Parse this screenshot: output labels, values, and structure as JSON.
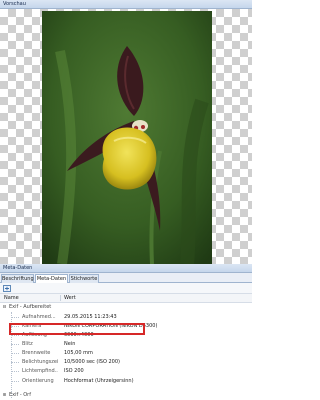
{
  "preview": {
    "title": "Vorschau"
  },
  "metadata_panel": {
    "title": "Meta-Daten",
    "tabs": [
      {
        "label": "Beschriftung",
        "active": false
      },
      {
        "label": "Meta-Daten",
        "active": true
      },
      {
        "label": "Stichworte",
        "active": false
      }
    ],
    "toolbar": {
      "expand_icon": "expand-icon"
    },
    "columns": {
      "name": "Name",
      "value": "Wert"
    },
    "groups": [
      {
        "label": "Exif - Aufbereitet",
        "expanded": true
      },
      {
        "label": "Exif - Orf",
        "expanded": false
      }
    ],
    "properties": [
      {
        "name": "Aufnahmed...",
        "value": "29.05.2015 11:23:43"
      },
      {
        "name": "Kamera",
        "value": "NIKON CORPORATION (NIKON D5300)"
      },
      {
        "name": "Auflösung",
        "value": "6000×4000"
      },
      {
        "name": "Blitz",
        "value": "Nein"
      },
      {
        "name": "Brennweite",
        "value": "105,00 mm"
      },
      {
        "name": "Belichtungszeit",
        "value": "10/5000 sec (ISO 200)"
      },
      {
        "name": "Lichtempfind...",
        "value": "ISO 200"
      },
      {
        "name": "Orientierung",
        "value": "Hochformat (Uhrzeigersinn)"
      }
    ],
    "highlight_color": "#d62828"
  }
}
